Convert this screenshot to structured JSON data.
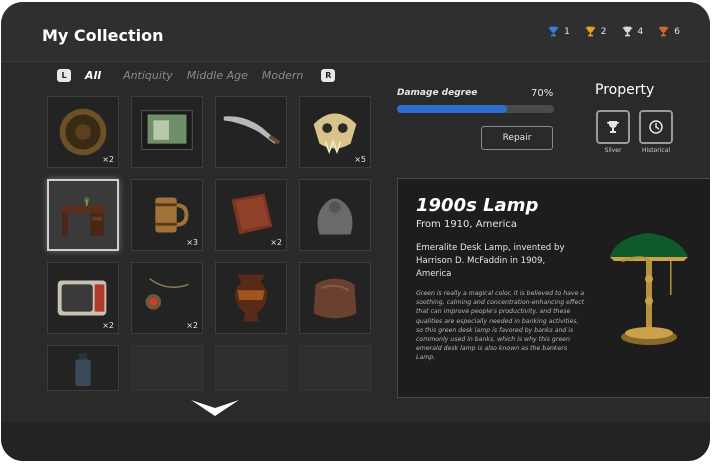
{
  "header": {
    "title": "My Collection",
    "trophies": [
      {
        "name": "blue-trophy-icon",
        "color": "#3c7fd8",
        "count": "1"
      },
      {
        "name": "gold-trophy-icon",
        "color": "#e2a21e",
        "count": "2"
      },
      {
        "name": "silver-trophy-icon",
        "color": "#d8d8d8",
        "count": "4"
      },
      {
        "name": "bronze-trophy-icon",
        "color": "#d2672c",
        "count": "6"
      }
    ]
  },
  "tabs": {
    "left_key": "L",
    "right_key": "R",
    "items": [
      "All",
      "Antiquity",
      "Middle Age",
      "Modern"
    ],
    "active": "All"
  },
  "grid": {
    "items": [
      {
        "name": "bowl-item",
        "qty": "×2"
      },
      {
        "name": "tv-screen-item",
        "qty": ""
      },
      {
        "name": "curved-blade-item",
        "qty": ""
      },
      {
        "name": "animal-skull-item",
        "qty": "×5"
      },
      {
        "name": "desk-item",
        "qty": "",
        "selected": true
      },
      {
        "name": "tankard-item",
        "qty": "×3"
      },
      {
        "name": "book-item",
        "qty": "×2"
      },
      {
        "name": "stone-sculpture-item",
        "qty": ""
      },
      {
        "name": "retro-tv-item",
        "qty": "×2"
      },
      {
        "name": "amulet-item",
        "qty": "×2"
      },
      {
        "name": "vase-item",
        "qty": ""
      },
      {
        "name": "cloth-item",
        "qty": ""
      },
      {
        "name": "lantern-item",
        "qty": ""
      },
      {
        "name": "empty-slot",
        "qty": ""
      },
      {
        "name": "empty-slot",
        "qty": ""
      },
      {
        "name": "empty-slot",
        "qty": ""
      }
    ]
  },
  "damage": {
    "label": "Damage degree",
    "value_text": "70%",
    "value": 0.7,
    "color": "#2f6ecf"
  },
  "repair_label": "Repair",
  "property": {
    "title": "Property",
    "badges": [
      {
        "icon": "trophy-icon",
        "label": "Silver"
      },
      {
        "icon": "clock-icon",
        "label": "Historical"
      }
    ]
  },
  "detail": {
    "title": "1900s Lamp",
    "subtitle": "From 1910, America",
    "summary": "Emeralite Desk Lamp, invented by Harrison D. McFaddin in 1909, America",
    "body": "Green is really a magical color, it is believed to have a soothing, calming and concentration-enhancing effect that can improve people's productivity, and these qualities are especially needed in banking activities, so this green desk lamp is favored by banks and is commonly used in banks, which is why this green emerald desk lamp is also known as the bankers Lamp."
  }
}
